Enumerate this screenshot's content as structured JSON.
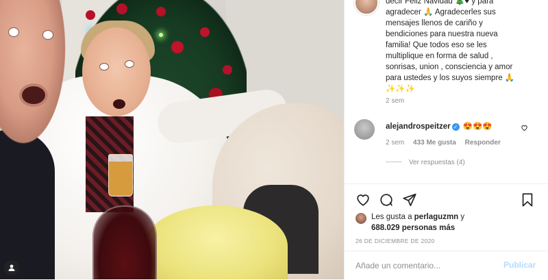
{
  "post": {
    "caption_lines": [
      "decir Feliz Navidad 🎄♥ y para",
      "agradecer 🙏 Agradecerles sus",
      "mensajes llenos de cariño y",
      "bendiciones para nuestra nueva",
      "familia! Que todos eso se les",
      "multiplique en forma de salud ,",
      "sonrisas, union , consciencia y amor",
      "para ustedes y los suyos siempre 🙏",
      "✨✨✨"
    ],
    "caption_time": "2 sem"
  },
  "comment": {
    "username": "alejandrospeitzer",
    "text": "😍😍😍",
    "time": "2 sem",
    "likes": "433 Me gusta",
    "reply": "Responder",
    "view_replies": "Ver respuestas (4)"
  },
  "likes": {
    "line1_prefix": "Les gusta a ",
    "user": "perlaguzmn",
    "line1_suffix": " y",
    "count": "688.029",
    "count_suffix": " personas más"
  },
  "date": "26 DE DICIEMBRE DE 2020",
  "comment_box": {
    "placeholder": "Añade un comentario...",
    "post_label": "Publicar"
  },
  "colors": {
    "accent": "#3897f0",
    "post_disabled": "#b3dbff",
    "muted": "#8e8e8e",
    "text": "#262626"
  },
  "icons": [
    "heart-icon",
    "comment-icon",
    "share-icon",
    "bookmark-icon",
    "verified-icon",
    "user-tag-icon"
  ]
}
